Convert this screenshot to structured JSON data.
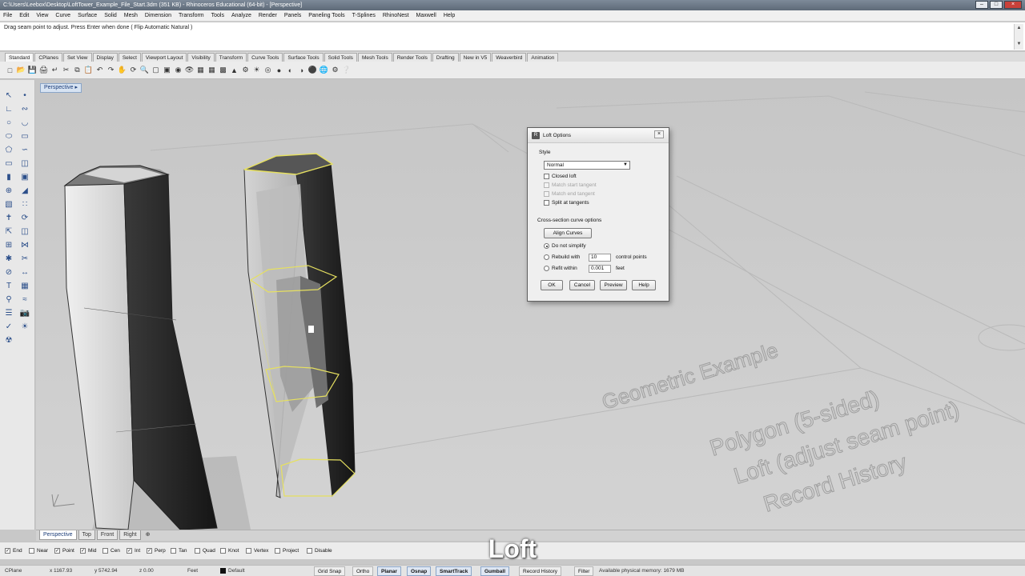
{
  "window": {
    "title": "C:\\Users\\Leebox\\Desktop\\LoftTower_Example_File_Start.3dm (351 KB) - Rhinoceros Educational (64-bit) - [Perspective]"
  },
  "menu": [
    "File",
    "Edit",
    "View",
    "Curve",
    "Surface",
    "Solid",
    "Mesh",
    "Dimension",
    "Transform",
    "Tools",
    "Analyze",
    "Render",
    "Panels",
    "Paneling Tools",
    "T-Splines",
    "RhinoNest",
    "Maxwell",
    "Help"
  ],
  "command": {
    "history": "Drag seam point to adjust. Press Enter when done ( Flip  Automatic  Natural )",
    "input_value": ""
  },
  "toolbar_tabs": [
    "Standard",
    "CPlanes",
    "Set View",
    "Display",
    "Select",
    "Viewport Layout",
    "Visibility",
    "Transform",
    "Curve Tools",
    "Surface Tools",
    "Solid Tools",
    "Mesh Tools",
    "Render Tools",
    "Drafting",
    "New in V5",
    "Weaverbird",
    "Animation"
  ],
  "toolbar_icons": [
    "new-file-icon",
    "open-file-icon",
    "save-icon",
    "print-icon",
    "import-icon",
    "cut-icon",
    "copy-icon",
    "paste-icon",
    "undo-icon",
    "redo-icon",
    "pan-icon",
    "rotate-view-icon",
    "zoom-icon",
    "zoom-window-icon",
    "zoom-extents-icon",
    "zoom-selected-icon",
    "named-views-icon",
    "viewport-layout-icon",
    "cplane-icon",
    "grid-icon",
    "layer-icon",
    "properties-icon",
    "lights-icon",
    "object-snap-icon",
    "render-icon",
    "material-icon",
    "shade-icon",
    "rendered-sphere-icon",
    "environment-icon",
    "options-icon",
    "help-icon"
  ],
  "sidebar_icons": [
    "select-icon",
    "point-icon",
    "polyline-icon",
    "curve-icon",
    "circle-icon",
    "arc-icon",
    "ellipse-icon",
    "rectangle-icon",
    "polygon-icon",
    "freeform-icon",
    "surface-icon",
    "loft-icon",
    "extrude-icon",
    "solid-box-icon",
    "boolean-icon",
    "fillet-icon",
    "mesh-icon",
    "edit-points-icon",
    "move-icon",
    "rotate-icon",
    "scale-icon",
    "mirror-icon",
    "array-icon",
    "join-icon",
    "explode-icon",
    "trim-icon",
    "split-icon",
    "dimension-icon",
    "text-icon",
    "hatch-icon",
    "analyze-icon",
    "curvature-icon",
    "layer-state-icon",
    "snapshot-icon",
    "check-icon",
    "render-sidebar-icon",
    "spray-icon"
  ],
  "viewport": {
    "label": "Perspective",
    "scene_text": [
      "Geometric Example",
      "Polygon (5-sided)",
      "Loft (adjust seam point)",
      "Record History"
    ]
  },
  "loft_dialog": {
    "title": "Loft Options",
    "style_label": "Style",
    "style_value": "Normal",
    "checks": [
      {
        "label": "Closed loft",
        "checked": false,
        "enabled": true
      },
      {
        "label": "Match start tangent",
        "checked": false,
        "enabled": false
      },
      {
        "label": "Match end tangent",
        "checked": false,
        "enabled": false
      },
      {
        "label": "Split at tangents",
        "checked": false,
        "enabled": true
      }
    ],
    "cross_section_label": "Cross-section curve options",
    "align_button": "Align Curves",
    "radios": [
      {
        "label": "Do not simplify",
        "selected": true
      },
      {
        "label": "Rebuild with",
        "selected": false,
        "value": "10",
        "unit": "control points"
      },
      {
        "label": "Refit within",
        "selected": false,
        "value": "0.001",
        "unit": "feet"
      }
    ],
    "buttons": [
      "OK",
      "Cancel",
      "Preview",
      "Help"
    ]
  },
  "viewport_tabs": [
    "Perspective",
    "Top",
    "Front",
    "Right"
  ],
  "osnaps": [
    {
      "label": "End",
      "checked": true
    },
    {
      "label": "Near",
      "checked": false
    },
    {
      "label": "Point",
      "checked": true
    },
    {
      "label": "Mid",
      "checked": true
    },
    {
      "label": "Cen",
      "checked": false
    },
    {
      "label": "Int",
      "checked": true
    },
    {
      "label": "Perp",
      "checked": true
    },
    {
      "label": "Tan",
      "checked": false
    },
    {
      "label": "Quad",
      "checked": false
    },
    {
      "label": "Knot",
      "checked": false
    },
    {
      "label": "Vertex",
      "checked": false
    },
    {
      "label": "Project",
      "checked": false
    },
    {
      "label": "Disable",
      "checked": false
    }
  ],
  "caption": "Loft",
  "status": {
    "cplane": "CPlane",
    "x": "x 1167.93",
    "y": "y 5742.94",
    "z": "z 0.00",
    "units": "Feet",
    "layer": "Default",
    "grid_snap": "Grid Snap",
    "ortho": "Ortho",
    "planar": "Planar",
    "osnap": "Osnap",
    "smarttrack": "SmartTrack",
    "gumball": "Gumball",
    "record_history": "Record History",
    "filter": "Filter",
    "memory": "Available physical memory: 1679 MB"
  },
  "colors": {
    "viewport_bg": "#cfcfcf",
    "selection_yellow": "#e6e060",
    "tower_dark": "#1c1c1c",
    "tower_light": "#e2e2e2"
  }
}
